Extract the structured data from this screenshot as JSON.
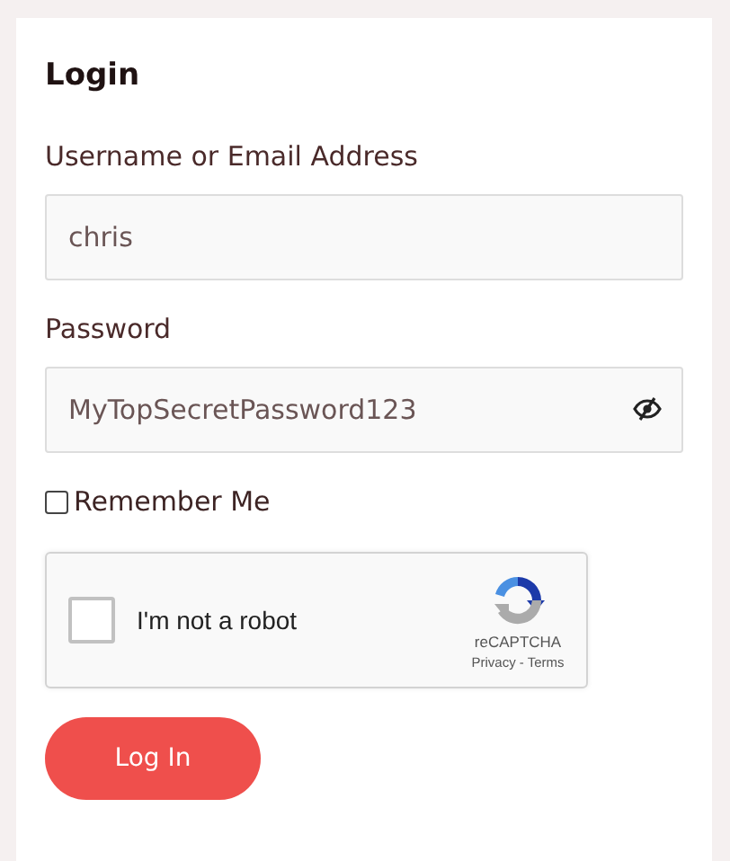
{
  "title": "Login",
  "fields": [
    {
      "label": "Username or Email Address",
      "value": "chris",
      "kind": "text"
    },
    {
      "label": "Password",
      "value": "MyTopSecretPassword123",
      "kind": "password"
    }
  ],
  "remember": {
    "label": "Remember Me",
    "checked": false
  },
  "captcha": {
    "label": "I'm not a robot",
    "checked": false,
    "brand": "reCAPTCHA",
    "links": [
      "Privacy",
      "Terms"
    ],
    "separator": "-"
  },
  "submit": "Log In"
}
